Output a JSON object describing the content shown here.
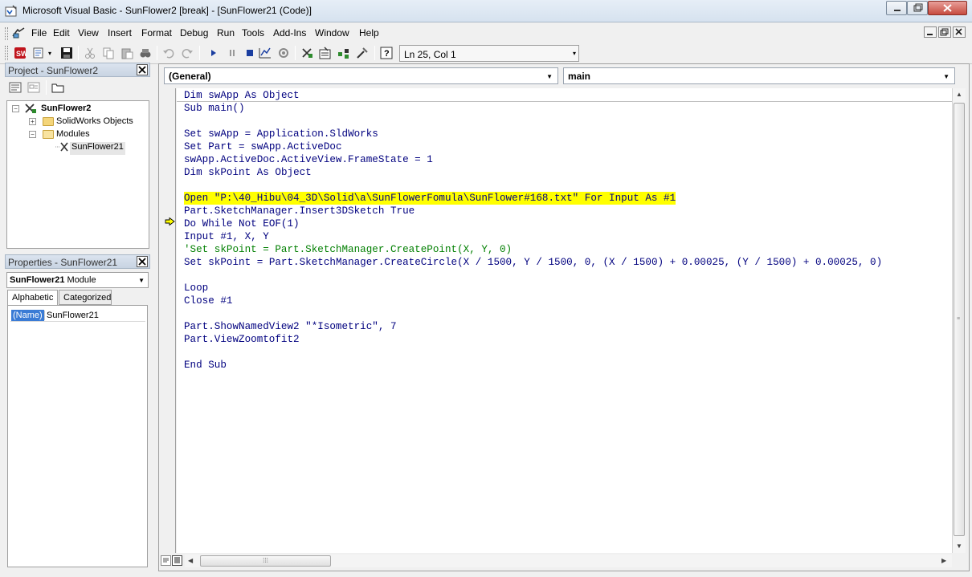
{
  "window": {
    "title": "Microsoft Visual Basic - SunFlower2 [break] - [SunFlower21 (Code)]",
    "icon": "vb-app-icon"
  },
  "menu": {
    "items": [
      "File",
      "Edit",
      "View",
      "Insert",
      "Format",
      "Debug",
      "Run",
      "Tools",
      "Add-Ins",
      "Window",
      "Help"
    ]
  },
  "toolbar": {
    "icons": [
      "solidworks-icon",
      "insert-module-icon",
      "save-icon",
      "cut-icon",
      "copy-icon",
      "paste-icon",
      "find-icon",
      "undo-icon",
      "redo-icon",
      "run-icon",
      "break-icon",
      "reset-icon",
      "design-mode-icon",
      "userform-icon",
      "project-explorer-icon",
      "properties-window-icon",
      "object-browser-icon",
      "toolbox-icon",
      "help-icon"
    ],
    "cursor_position": "Ln 25, Col 1"
  },
  "project": {
    "title": "Project - SunFlower2",
    "tree": {
      "root": "SunFlower2",
      "folder1": "SolidWorks Objects",
      "folder2": "Modules",
      "module": "SunFlower21"
    }
  },
  "properties": {
    "title": "Properties - SunFlower21",
    "object_name": "SunFlower21",
    "object_type": "Module",
    "tabs": [
      "Alphabetic",
      "Categorized"
    ],
    "rows": [
      {
        "name": "(Name)",
        "value": "SunFlower21"
      }
    ]
  },
  "code": {
    "object_combo": "(General)",
    "proc_combo": "main",
    "lines": {
      "l0": {
        "kw1": "Dim",
        "mid1": " swApp ",
        "kw2": "As Object"
      },
      "l1": {
        "kw1": "Sub",
        "rest": " main()"
      },
      "l3": {
        "kw1": "Set",
        "rest": " swApp = Application.SldWorks"
      },
      "l4": {
        "kw1": "Set",
        "rest": " Part = swApp.ActiveDoc"
      },
      "l5": {
        "text": "swApp.ActiveDoc.ActiveView.FrameState = 1"
      },
      "l6": {
        "kw1": "Dim",
        "mid1": " skPoint ",
        "kw2": "As Object"
      },
      "l8": {
        "text": "Open \"P:\\40_Hibu\\04_3D\\Solid\\a\\SunFlowerFomula\\SunFlower#168.txt\" For Input As #1"
      },
      "l9": {
        "rest": "Part.SketchManager.Insert3DSketch ",
        "kw1": "True"
      },
      "l10": {
        "kw1": "Do While Not",
        "rest": " EOF(1)"
      },
      "l11": {
        "kw1": "Input",
        "rest": " #1, X, Y"
      },
      "l12": {
        "text": "'Set skPoint = Part.SketchManager.CreatePoint(X, Y, 0)"
      },
      "l13": {
        "kw1": "Set",
        "rest": " skPoint = Part.SketchManager.CreateCircle(X / 1500, Y / 1500, 0, (X / 1500) + 0.00025, (Y / 1500) + 0.00025, 0)"
      },
      "l15": {
        "kw1": "Loop"
      },
      "l16": {
        "kw1": "Close",
        "rest": " #1"
      },
      "l18": {
        "text": "Part.ShowNamedView2 \"*Isometric\", 7"
      },
      "l19": {
        "text": "Part.ViewZoomtofit2"
      },
      "l21": {
        "kw1": "End Sub"
      }
    }
  },
  "colors": {
    "keyword": "#00007f",
    "comment": "#007f00",
    "execution_highlight": "#ffff00"
  }
}
